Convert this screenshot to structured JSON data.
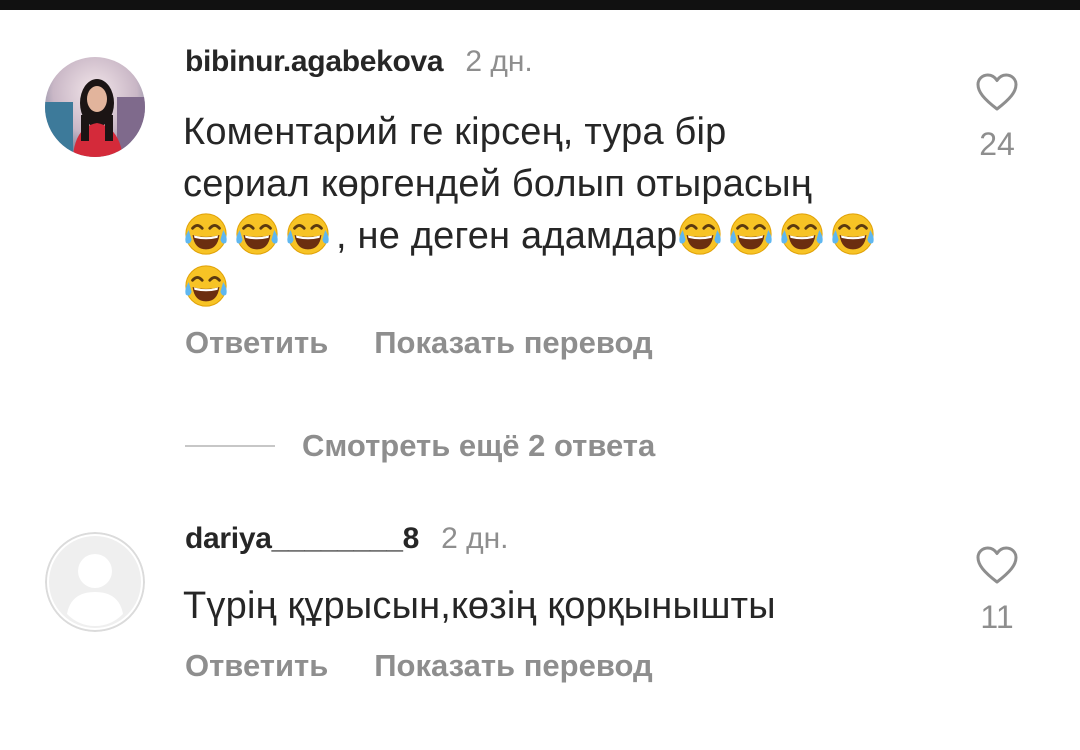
{
  "comments": [
    {
      "username": "bibinur.agabekova",
      "timestamp": "2 дн.",
      "text_line1": "Коментарий ге кірсең, тура бір",
      "text_line2": "сериал көргендей болып отырасың",
      "text_line3": ", не деген адамдар",
      "emoji": "face-with-tears-of-joy",
      "likes": "24",
      "reply_label": "Ответить",
      "translate_label": "Показать перевод"
    },
    {
      "username": "dariya________8",
      "timestamp": "2 дн.",
      "text": "Түрің құрысын,көзің қорқынышты",
      "likes": "11",
      "reply_label": "Ответить",
      "translate_label": "Показать перевод"
    }
  ],
  "replies": {
    "label": "Смотреть ещё 2 ответа"
  },
  "colors": {
    "text_primary": "#262626",
    "text_secondary": "#8e8e8e",
    "divider": "#c7c7c7",
    "emoji_face": "#f7c325"
  }
}
